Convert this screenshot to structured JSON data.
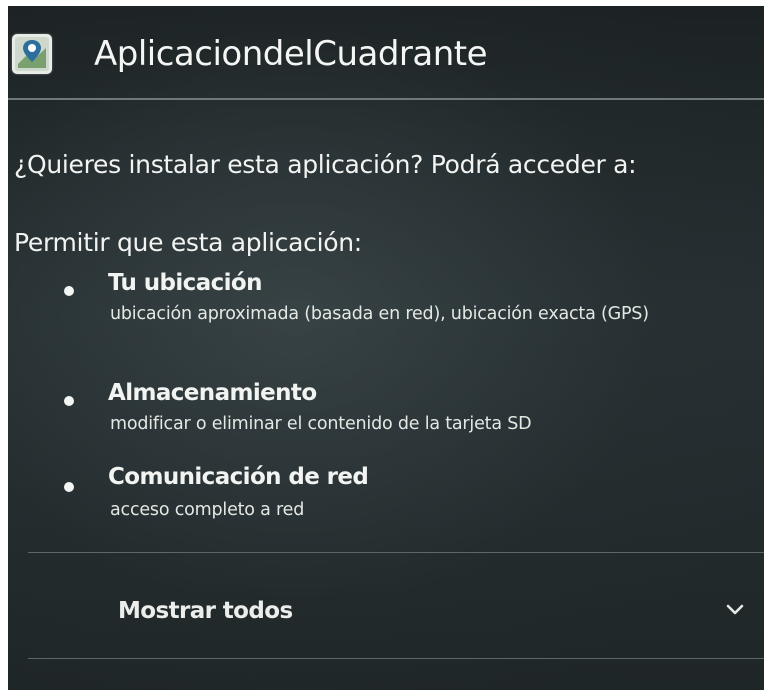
{
  "header": {
    "app_name": "AplicaciondelCuadrante",
    "app_icon": "map-pin-icon"
  },
  "install": {
    "question": "¿Quieres instalar esta aplicación? Podrá acceder a:",
    "permit_heading": "Permitir que esta aplicación:"
  },
  "permissions": [
    {
      "title": "Tu ubicación",
      "description": "ubicación aproximada (basada en red), ubicación exacta (GPS)"
    },
    {
      "title": "Almacenamiento",
      "description": "modificar o eliminar el contenido de la tarjeta SD"
    },
    {
      "title": "Comunicación de red",
      "description": "acceso completo a red"
    }
  ],
  "footer": {
    "show_all_label": "Mostrar todos",
    "expand_icon": "chevron-down-icon"
  }
}
